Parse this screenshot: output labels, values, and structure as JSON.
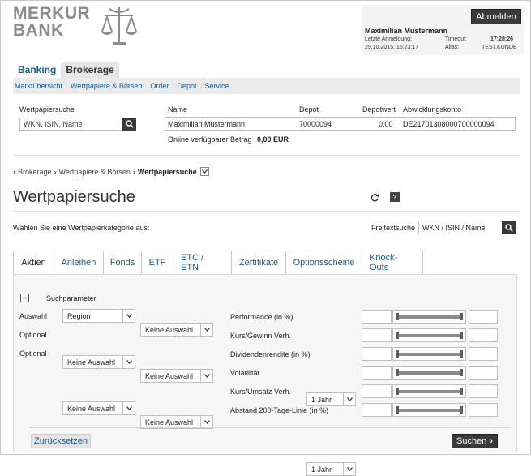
{
  "logo": {
    "line1": "MERKUR",
    "line2": "BANK"
  },
  "user": {
    "logout_label": "Abmelden",
    "name": "Maximilian Mustermann",
    "last_login_label": "Letzte Anmeldung:",
    "last_login_value": "29.10.2015, 15:23:17",
    "timeout_label": "Timeout:",
    "timeout_value": "17:28:26",
    "alias_label": "Alias:",
    "alias_value": "TEST.KUNDE"
  },
  "main_tabs": [
    {
      "label": "Banking"
    },
    {
      "label": "Brokerage"
    }
  ],
  "subnav": [
    {
      "label": "Marktübersicht"
    },
    {
      "label": "Wertpapiere & Börsen"
    },
    {
      "label": "Order"
    },
    {
      "label": "Depot"
    },
    {
      "label": "Service"
    }
  ],
  "search_panel": {
    "title": "Wertpapiersuche",
    "placeholder": "WKN, ISIN, Name",
    "col_name": "Name",
    "col_depot": "Depot",
    "col_depotwert": "Depotwert",
    "col_konto": "Abwicklungskonto",
    "val_name": "Maximilian Mustermann",
    "val_depot": "70000094",
    "val_depotwert": "0,00",
    "val_konto": "DE21701308000700000094",
    "available_label": "Online verfügbarer Betrag",
    "available_value": "0,00 EUR"
  },
  "breadcrumb": {
    "item1": "Brokerage",
    "item2": "Wertpapiere & Börsen",
    "item3": "Wertpapiersuche"
  },
  "page_title": "Wertpapiersuche",
  "category_prompt": "Wählen Sie eine Wertpapierkategorie aus:",
  "freitext": {
    "label": "Freitextsuche",
    "placeholder": "WKN / ISIN / Name"
  },
  "category_tabs": [
    {
      "label": "Aktien"
    },
    {
      "label": "Anleihen"
    },
    {
      "label": "Fonds"
    },
    {
      "label": "ETF"
    },
    {
      "label": "ETC / ETN"
    },
    {
      "label": "Zertifikate"
    },
    {
      "label": "Optionsscheine"
    },
    {
      "label": "Knock-Outs"
    }
  ],
  "params": {
    "title": "Suchparameter",
    "rows": [
      {
        "label": "Auswahl",
        "sel1": "Region",
        "sel2": "Keine Auswahl"
      },
      {
        "label": "Optional",
        "sel1": "Keine Auswahl",
        "sel2": "Keine Auswahl"
      },
      {
        "label": "Optional",
        "sel1": "Keine Auswahl",
        "sel2": "Keine Auswahl"
      }
    ],
    "sliders": [
      {
        "label": "Performance (in %)",
        "period": "1 Jahr"
      },
      {
        "label": "Kurs/Gewinn Verh."
      },
      {
        "label": "Dividendenrendite (in %)"
      },
      {
        "label": "Volatilität",
        "period": "1 Jahr"
      },
      {
        "label": "Kurs/Umsatz Verh."
      },
      {
        "label": "Abstand 200-Tage-Linie (in %)"
      }
    ],
    "reset_label": "Zurücksetzen",
    "search_label": "Suchen"
  }
}
